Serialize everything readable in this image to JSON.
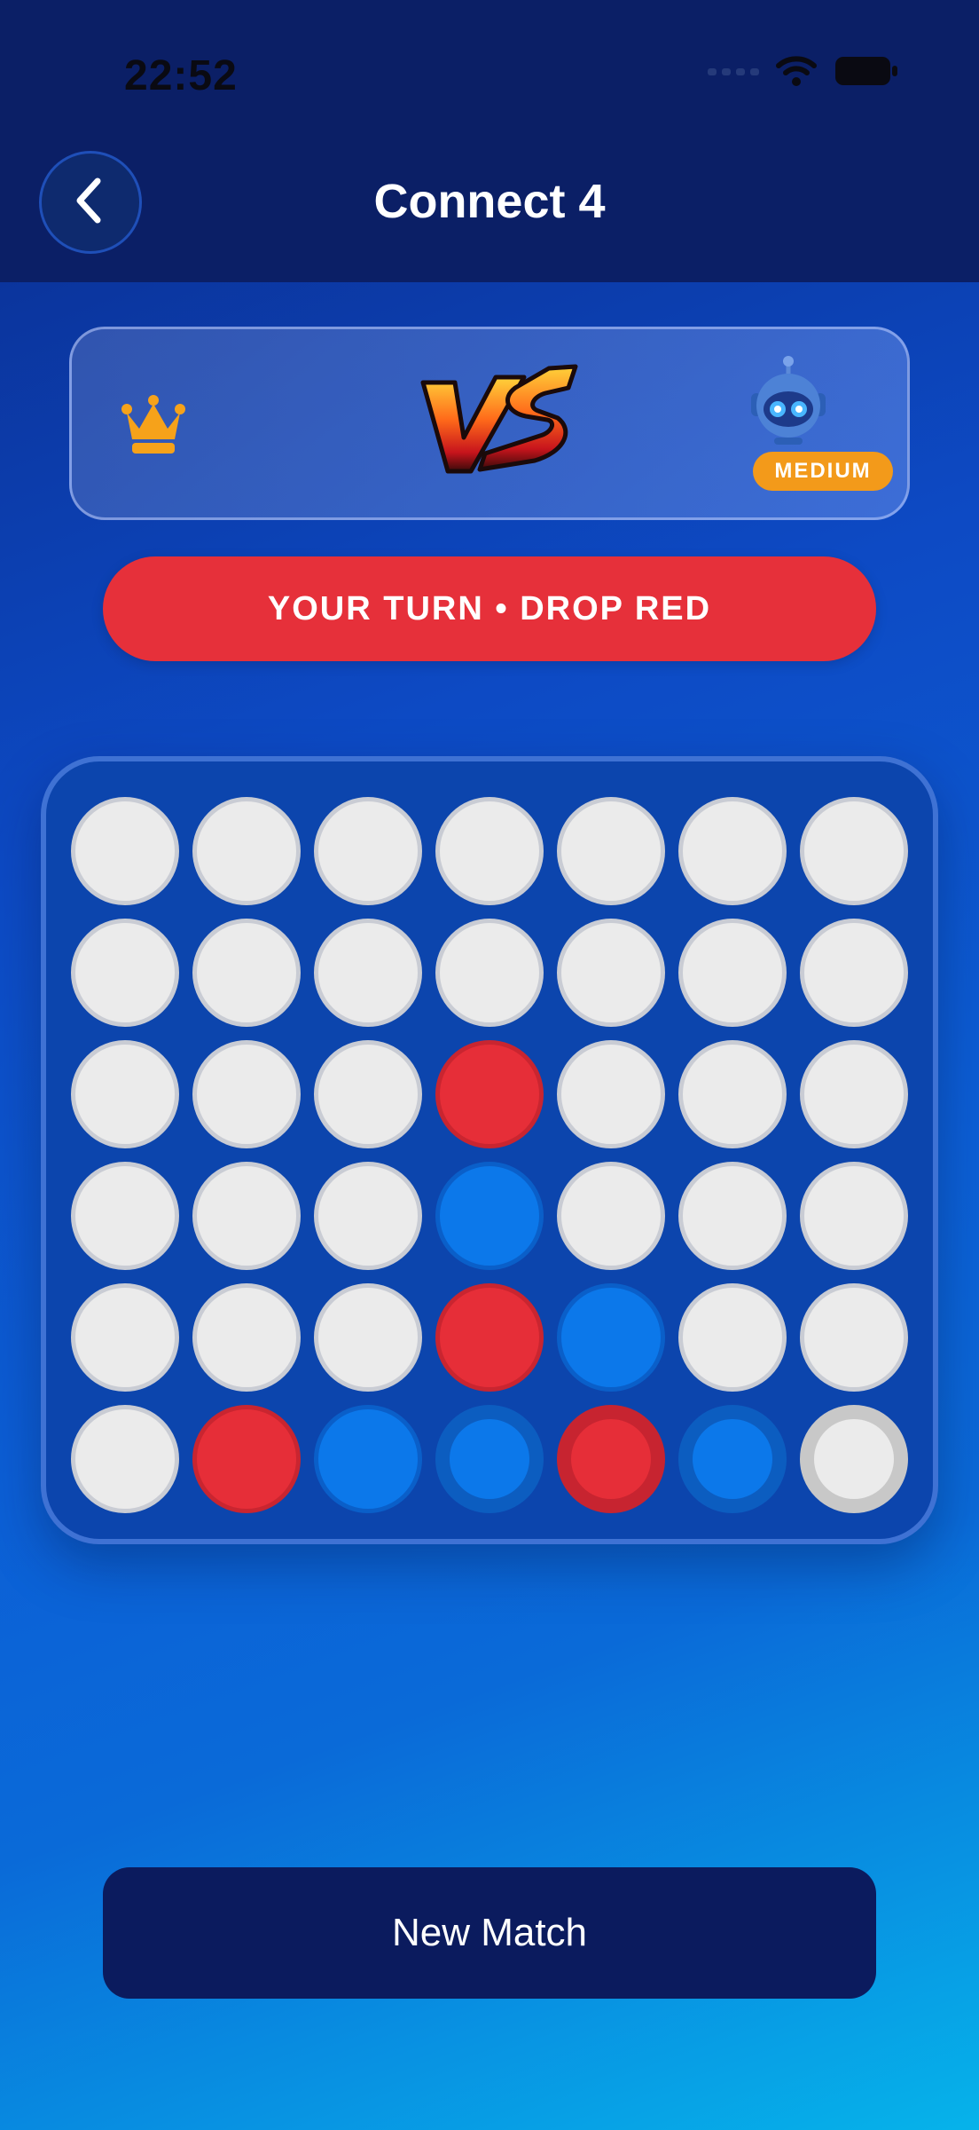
{
  "status_bar": {
    "time": "22:52",
    "icons": [
      "signal-icon",
      "wifi-icon",
      "battery-icon"
    ]
  },
  "header": {
    "title": "Connect 4",
    "back_icon": "chevron-left-icon"
  },
  "matchup": {
    "player_icon": "crown-icon",
    "vs_graphic": "vs-logo",
    "opponent_icon": "robot-icon",
    "difficulty": "MEDIUM"
  },
  "turn": {
    "label": "YOUR TURN  •  DROP RED"
  },
  "board": {
    "columns": 7,
    "rows": 6,
    "grid": [
      [
        "empty",
        "empty",
        "empty",
        "empty",
        "empty",
        "empty",
        "empty"
      ],
      [
        "empty",
        "empty",
        "empty",
        "empty",
        "empty",
        "empty",
        "empty"
      ],
      [
        "empty",
        "empty",
        "empty",
        "red",
        "empty",
        "empty",
        "empty"
      ],
      [
        "empty",
        "empty",
        "empty",
        "blue",
        "empty",
        "empty",
        "empty"
      ],
      [
        "empty",
        "empty",
        "empty",
        "red",
        "blue",
        "empty",
        "empty"
      ],
      [
        "empty",
        "red",
        "blue",
        "blue",
        "red",
        "blue",
        "empty"
      ]
    ],
    "highlighted_row": 5,
    "highlighted_cols": [
      3,
      4,
      5,
      6
    ]
  },
  "colors": {
    "red": "#e62e38",
    "blue": "#0c78ea",
    "empty": "#ebebeb",
    "accent": "#f39a1a"
  },
  "actions": {
    "new_match": "New Match"
  }
}
